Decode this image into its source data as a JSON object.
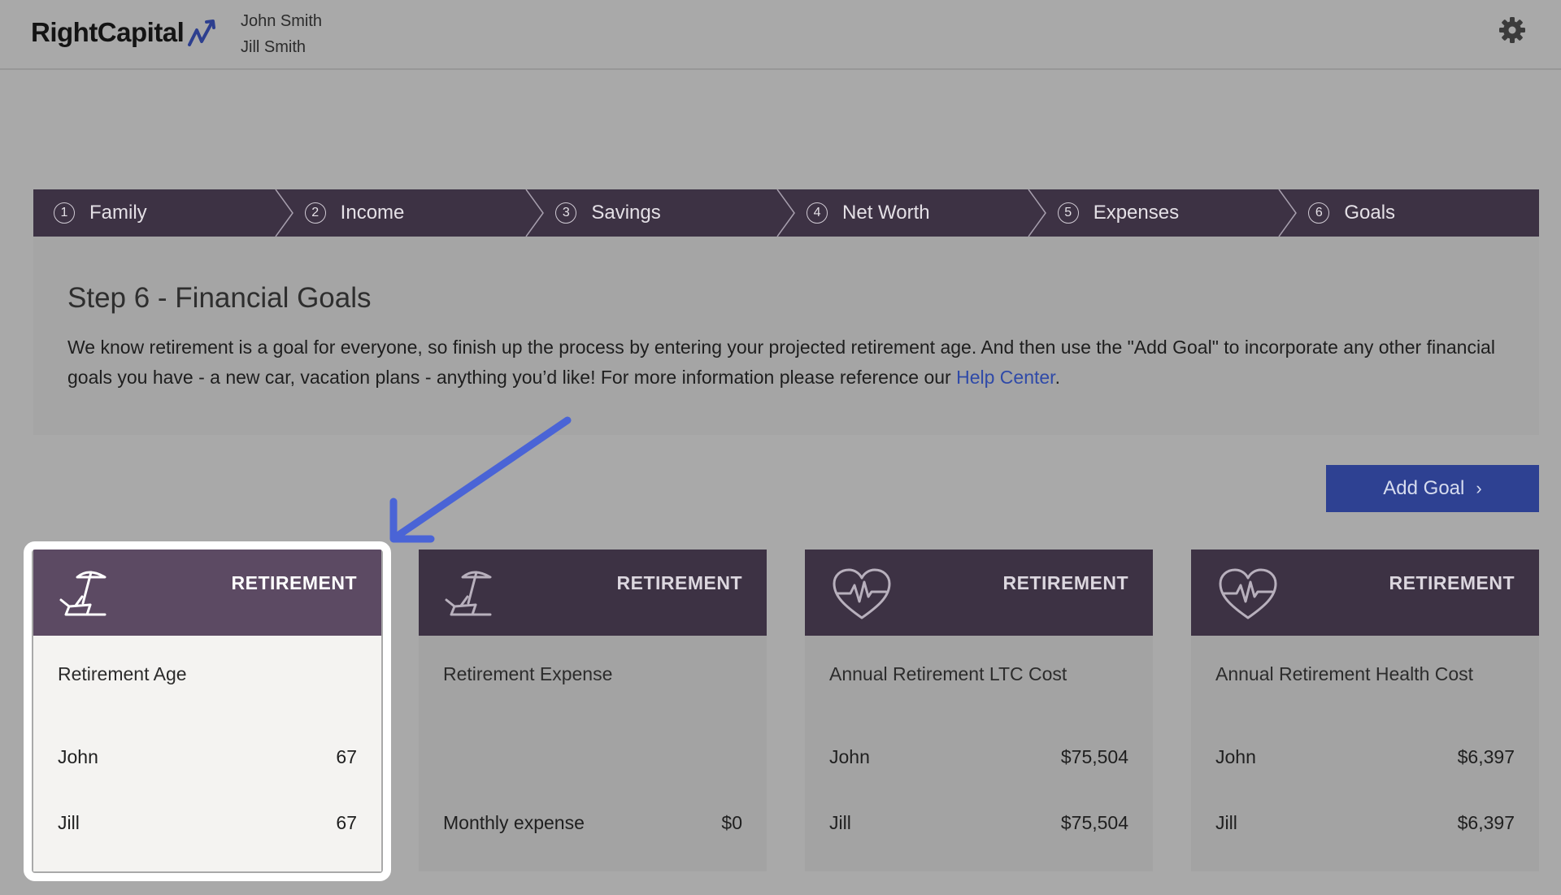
{
  "header": {
    "logo_text": "RightCapital",
    "clients": [
      "John Smith",
      "Jill Smith"
    ]
  },
  "stepper": {
    "steps": [
      {
        "num": "1",
        "label": "Family"
      },
      {
        "num": "2",
        "label": "Income"
      },
      {
        "num": "3",
        "label": "Savings"
      },
      {
        "num": "4",
        "label": "Net Worth"
      },
      {
        "num": "5",
        "label": "Expenses"
      },
      {
        "num": "6",
        "label": "Goals"
      }
    ]
  },
  "info": {
    "title": "Step 6 - Financial Goals",
    "body_before_link": "We know retirement is a goal for everyone, so finish up the process by entering your projected retirement age. And then use the \"Add Goal\" to incorporate any other financial goals you have - a new car, vacation plans - anything you’d like! For more information please reference our ",
    "link_text": "Help Center",
    "body_after_link": "."
  },
  "add_goal": {
    "label": "Add Goal",
    "chevron": "›"
  },
  "cards": [
    {
      "tag": "RETIREMENT",
      "icon": "beach-chair-icon",
      "title": "Retirement Age",
      "rows": [
        {
          "label": "John",
          "value": "67"
        },
        {
          "label": "Jill",
          "value": "67"
        }
      ]
    },
    {
      "tag": "RETIREMENT",
      "icon": "beach-chair-icon",
      "title": "Retirement Expense",
      "rows": [
        {
          "label": "Monthly expense",
          "value": "$0"
        }
      ]
    },
    {
      "tag": "RETIREMENT",
      "icon": "heart-pulse-icon",
      "title": "Annual Retirement LTC Cost",
      "rows": [
        {
          "label": "John",
          "value": "$75,504"
        },
        {
          "label": "Jill",
          "value": "$75,504"
        }
      ]
    },
    {
      "tag": "RETIREMENT",
      "icon": "heart-pulse-icon",
      "title": "Annual Retirement Health Cost",
      "rows": [
        {
          "label": "John",
          "value": "$6,397"
        },
        {
          "label": "Jill",
          "value": "$6,397"
        }
      ]
    }
  ],
  "colors": {
    "background": "#a9a9a9",
    "header_dark": "#3d3244",
    "highlight_head": "#5c4a63",
    "button": "#2e4192",
    "link": "#2f4aa8",
    "annotation_arrow": "#4a64d6"
  }
}
